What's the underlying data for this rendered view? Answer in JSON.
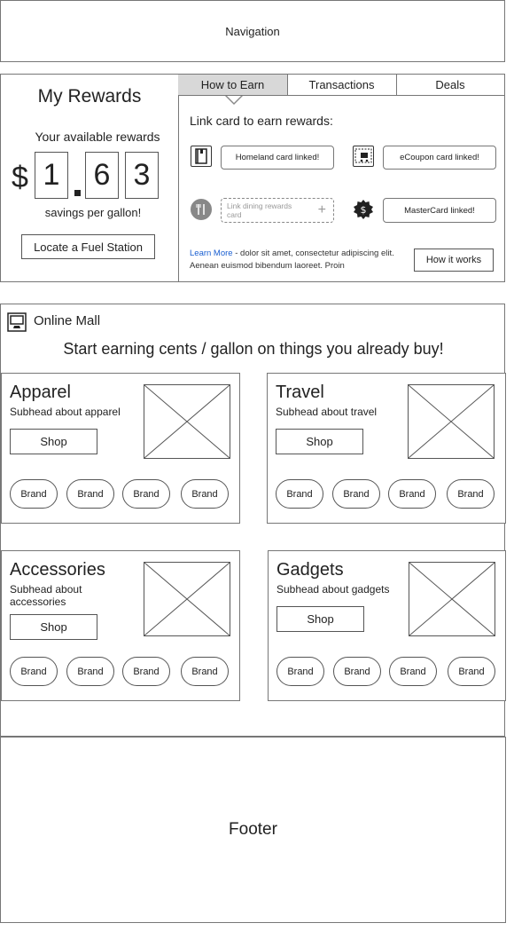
{
  "navigation": {
    "label": "Navigation"
  },
  "rewards": {
    "title": "My Rewards",
    "available_label": "Your available rewards",
    "currency": "$",
    "digits": [
      "1",
      "6",
      "3"
    ],
    "savings_label": "savings per gallon!",
    "locate_button": "Locate a Fuel Station"
  },
  "tabs": [
    {
      "label": "How to Earn",
      "active": true
    },
    {
      "label": "Transactions",
      "active": false
    },
    {
      "label": "Deals",
      "active": false
    }
  ],
  "earn": {
    "title": "Link card to earn rewards:",
    "cards": [
      {
        "icon": "book-icon",
        "label": "Homeland card linked!"
      },
      {
        "icon": "shopping-cart-icon",
        "label": "eCoupon card linked!"
      },
      {
        "icon": "dining-icon",
        "label": "Link dining rewards card",
        "add": "+"
      },
      {
        "icon": "dollar-badge-icon",
        "label": "MasterCard linked!"
      }
    ],
    "learn_more": "Learn More",
    "info_text": " - dolor sit amet, consectetur adipiscing elit. Aenean euismod bibendum laoreet. Proin",
    "how_button": "How it works"
  },
  "mall": {
    "title": "Online Mall",
    "subtitle": "Start earning cents / gallon on things you already buy!",
    "categories": [
      {
        "title": "Apparel",
        "subhead": "Subhead about apparel",
        "shop": "Shop",
        "brands": [
          "Brand",
          "Brand",
          "Brand",
          "Brand"
        ]
      },
      {
        "title": "Travel",
        "subhead": "Subhead about travel",
        "shop": "Shop",
        "brands": [
          "Brand",
          "Brand",
          "Brand",
          "Brand"
        ]
      },
      {
        "title": "Accessories",
        "subhead": "Subhead about accessories",
        "shop": "Shop",
        "brands": [
          "Brand",
          "Brand",
          "Brand",
          "Brand"
        ]
      },
      {
        "title": "Gadgets",
        "subhead": "Subhead about gadgets",
        "shop": "Shop",
        "brands": [
          "Brand",
          "Brand",
          "Brand",
          "Brand"
        ]
      }
    ]
  },
  "footer": {
    "label": "Footer"
  }
}
